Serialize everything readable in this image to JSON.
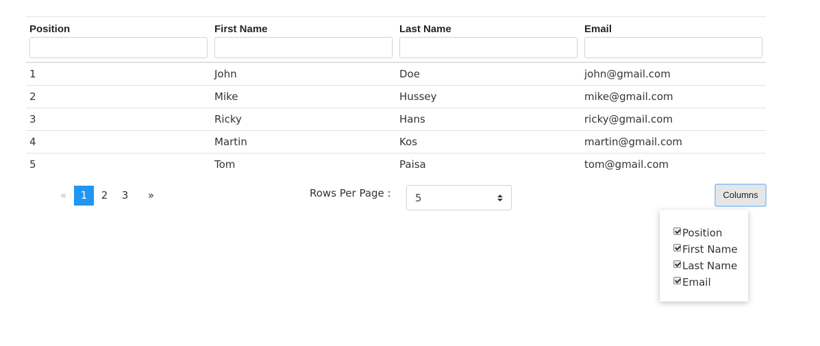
{
  "table": {
    "columns": [
      "Position",
      "First Name",
      "Last Name",
      "Email"
    ],
    "filter_values": [
      "",
      "",
      "",
      ""
    ],
    "rows": [
      [
        "1",
        "John",
        "Doe",
        "john@gmail.com"
      ],
      [
        "2",
        "Mike",
        "Hussey",
        "mike@gmail.com"
      ],
      [
        "3",
        "Ricky",
        "Hans",
        "ricky@gmail.com"
      ],
      [
        "4",
        "Martin",
        "Kos",
        "martin@gmail.com"
      ],
      [
        "5",
        "Tom",
        "Paisa",
        "tom@gmail.com"
      ]
    ]
  },
  "pagination": {
    "prev": "«",
    "pages": [
      "1",
      "2",
      "3"
    ],
    "active_page": "1",
    "next": "»"
  },
  "rows_per_page": {
    "label": "Rows Per Page :",
    "value": "5"
  },
  "columns_button": {
    "label": "Columns"
  },
  "columns_menu": {
    "items": [
      {
        "label": "Position",
        "checked": true
      },
      {
        "label": "First Name",
        "checked": true
      },
      {
        "label": "Last Name",
        "checked": true
      },
      {
        "label": "Email",
        "checked": true
      }
    ]
  },
  "colors": {
    "active_page_bg": "#2196f3",
    "button_focus_border": "#9ecbf5"
  }
}
